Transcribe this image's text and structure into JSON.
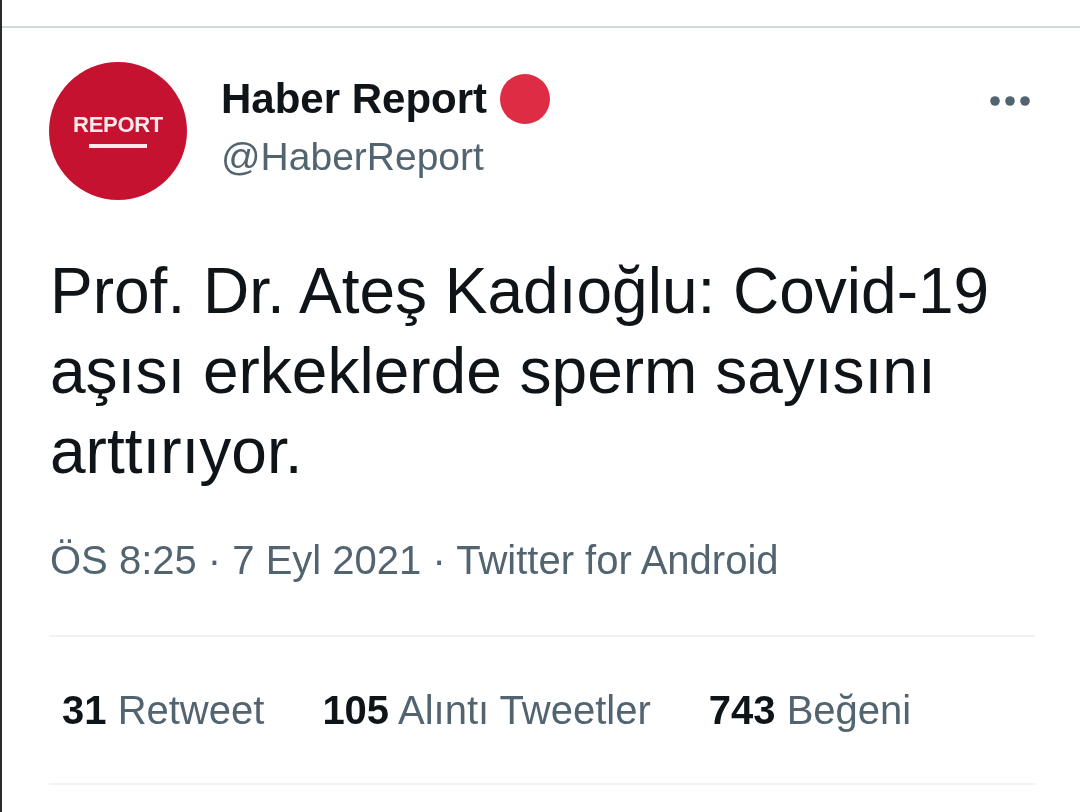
{
  "tweet": {
    "author": {
      "avatar_text": "REPORT",
      "name": "Haber Report",
      "handle": "@HaberReport"
    },
    "text": "Prof. Dr. Ateş Kadıoğlu: Covid-19 aşısı erkeklerde sperm sayısını arttırıyor.",
    "meta": "ÖS 8:25 · 7 Eyl 2021 · Twitter for Android",
    "stats": [
      {
        "count": "31",
        "label": "Retweet"
      },
      {
        "count": "105",
        "label": "Alıntı Tweetler"
      },
      {
        "count": "743",
        "label": "Beğeni"
      }
    ]
  }
}
